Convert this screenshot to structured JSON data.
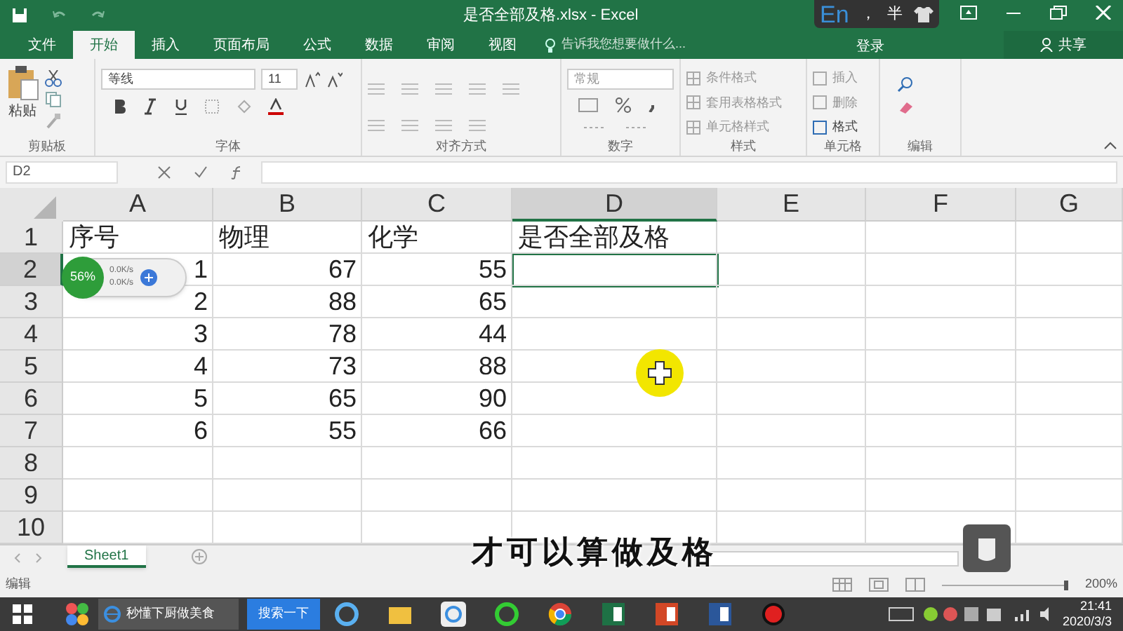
{
  "window": {
    "title": "是否全部及格.xlsx - Excel"
  },
  "ime": {
    "lang": "En",
    "punct": "，",
    "width": "半"
  },
  "tabs": [
    {
      "label": "文件",
      "selected": false
    },
    {
      "label": "开始",
      "selected": true
    },
    {
      "label": "插入",
      "selected": false
    },
    {
      "label": "页面布局",
      "selected": false
    },
    {
      "label": "公式",
      "selected": false
    },
    {
      "label": "数据",
      "selected": false
    },
    {
      "label": "审阅",
      "selected": false
    },
    {
      "label": "视图",
      "selected": false
    }
  ],
  "tell_me": {
    "placeholder": "告诉我您想要做什么..."
  },
  "account": {
    "login": "登录",
    "share": "共享"
  },
  "ribbon": {
    "paste": "粘贴",
    "font_name": "等线",
    "font_size": "11",
    "number_format": "常规",
    "styles": [
      "条件格式",
      "套用表格格式",
      "单元格样式"
    ],
    "cells": [
      "插入",
      "删除",
      "格式"
    ],
    "groups": [
      "剪贴板",
      "字体",
      "对齐方式",
      "数字",
      "样式",
      "单元格",
      "编辑"
    ]
  },
  "formula_bar": {
    "name_box": "D2"
  },
  "sheet": {
    "columns": [
      {
        "label": "A",
        "selected": false
      },
      {
        "label": "B",
        "selected": false
      },
      {
        "label": "C",
        "selected": false
      },
      {
        "label": "D",
        "selected": true
      },
      {
        "label": "E",
        "selected": false
      },
      {
        "label": "F",
        "selected": false
      },
      {
        "label": "G",
        "selected": false
      }
    ],
    "rows": [
      {
        "label": "1",
        "selected": false,
        "cells": [
          "序号",
          "物理",
          "化学",
          "是否全部及格"
        ]
      },
      {
        "label": "2",
        "selected": true,
        "cells": [
          "1",
          "67",
          "55",
          ""
        ]
      },
      {
        "label": "3",
        "selected": false,
        "cells": [
          "2",
          "88",
          "65",
          ""
        ]
      },
      {
        "label": "4",
        "selected": false,
        "cells": [
          "3",
          "78",
          "44",
          ""
        ]
      },
      {
        "label": "5",
        "selected": false,
        "cells": [
          "4",
          "73",
          "88",
          ""
        ]
      },
      {
        "label": "6",
        "selected": false,
        "cells": [
          "5",
          "65",
          "90",
          ""
        ]
      },
      {
        "label": "7",
        "selected": false,
        "cells": [
          "6",
          "55",
          "66",
          ""
        ]
      },
      {
        "label": "8",
        "selected": false,
        "cells": []
      },
      {
        "label": "9",
        "selected": false,
        "cells": []
      },
      {
        "label": "10",
        "selected": false,
        "cells": []
      }
    ]
  },
  "sheet_tabs": [
    {
      "label": "Sheet1",
      "selected": true
    }
  ],
  "status_bar": {
    "mode": "编辑",
    "zoom": "200%",
    "level": 1
  },
  "net_widget": {
    "percent": "56%",
    "up": "0.0K/s",
    "down": "0.0K/s"
  },
  "subtitle": "才可以算做及格",
  "taskbar": {
    "window": "秒懂下厨做美食",
    "search": "搜索一下",
    "time": "21:41",
    "date": "2020/3/3"
  }
}
